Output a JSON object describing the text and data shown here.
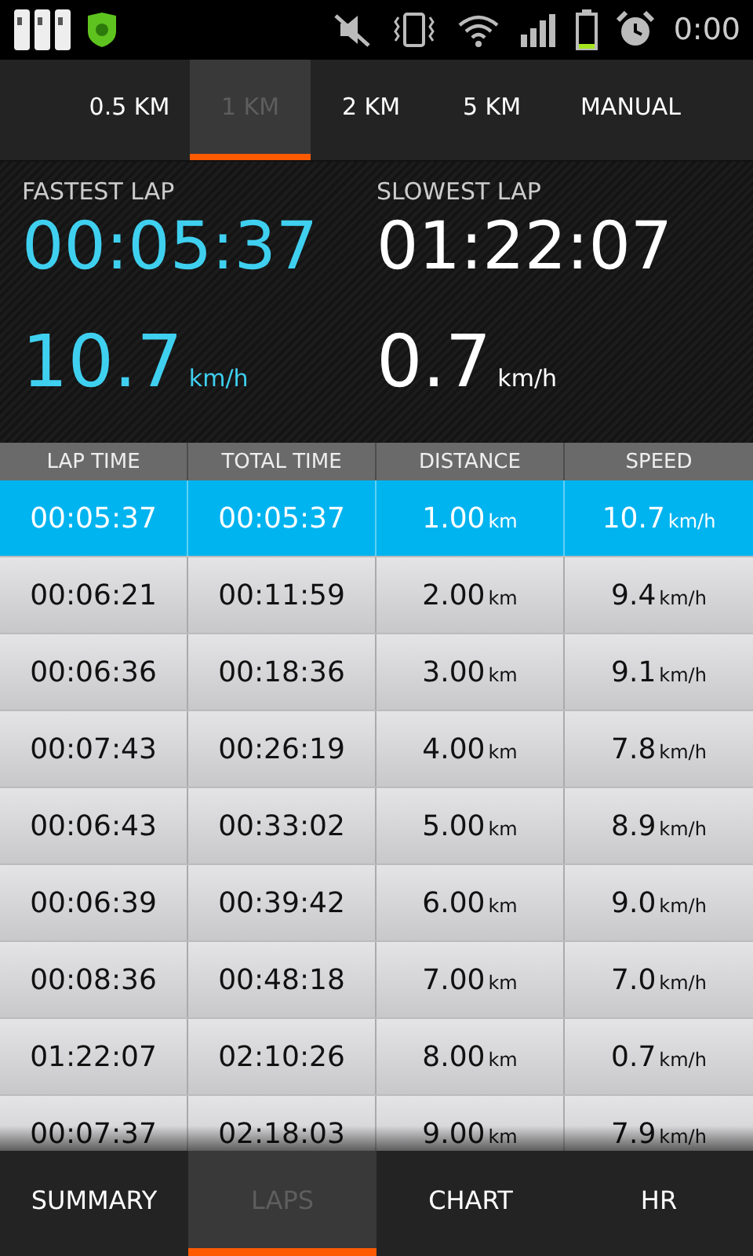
{
  "status_bar": {
    "time": "0:00"
  },
  "interval_tabs": [
    {
      "label": "0.5 KM",
      "selected": false
    },
    {
      "label": "1 KM",
      "selected": true
    },
    {
      "label": "2 KM",
      "selected": false
    },
    {
      "label": "5 KM",
      "selected": false
    },
    {
      "label": "MANUAL",
      "selected": false
    }
  ],
  "summary": [
    {
      "kind": "fastest",
      "title": "FASTEST LAP",
      "time": "00:05:37",
      "speed": "10.7",
      "unit": "km/h"
    },
    {
      "kind": "slowest",
      "title": "SLOWEST LAP",
      "time": "01:22:07",
      "speed": "0.7",
      "unit": "km/h"
    }
  ],
  "table": {
    "columns": [
      "LAP TIME",
      "TOTAL TIME",
      "DISTANCE",
      "SPEED"
    ],
    "rows": [
      {
        "lap_time": "00:05:37",
        "total_time": "00:05:37",
        "distance": "1.00",
        "distance_unit": "km",
        "speed": "10.7",
        "speed_unit": "km/h",
        "selected": true
      },
      {
        "lap_time": "00:06:21",
        "total_time": "00:11:59",
        "distance": "2.00",
        "distance_unit": "km",
        "speed": "9.4",
        "speed_unit": "km/h",
        "selected": false
      },
      {
        "lap_time": "00:06:36",
        "total_time": "00:18:36",
        "distance": "3.00",
        "distance_unit": "km",
        "speed": "9.1",
        "speed_unit": "km/h",
        "selected": false
      },
      {
        "lap_time": "00:07:43",
        "total_time": "00:26:19",
        "distance": "4.00",
        "distance_unit": "km",
        "speed": "7.8",
        "speed_unit": "km/h",
        "selected": false
      },
      {
        "lap_time": "00:06:43",
        "total_time": "00:33:02",
        "distance": "5.00",
        "distance_unit": "km",
        "speed": "8.9",
        "speed_unit": "km/h",
        "selected": false
      },
      {
        "lap_time": "00:06:39",
        "total_time": "00:39:42",
        "distance": "6.00",
        "distance_unit": "km",
        "speed": "9.0",
        "speed_unit": "km/h",
        "selected": false
      },
      {
        "lap_time": "00:08:36",
        "total_time": "00:48:18",
        "distance": "7.00",
        "distance_unit": "km",
        "speed": "7.0",
        "speed_unit": "km/h",
        "selected": false
      },
      {
        "lap_time": "01:22:07",
        "total_time": "02:10:26",
        "distance": "8.00",
        "distance_unit": "km",
        "speed": "0.7",
        "speed_unit": "km/h",
        "selected": false
      },
      {
        "lap_time": "00:07:37",
        "total_time": "02:18:03",
        "distance": "9.00",
        "distance_unit": "km",
        "speed": "7.9",
        "speed_unit": "km/h",
        "selected": false
      }
    ]
  },
  "bottom_tabs": [
    {
      "label": "SUMMARY",
      "selected": false
    },
    {
      "label": "LAPS",
      "selected": true
    },
    {
      "label": "CHART",
      "selected": false
    },
    {
      "label": "HR",
      "selected": false
    }
  ]
}
